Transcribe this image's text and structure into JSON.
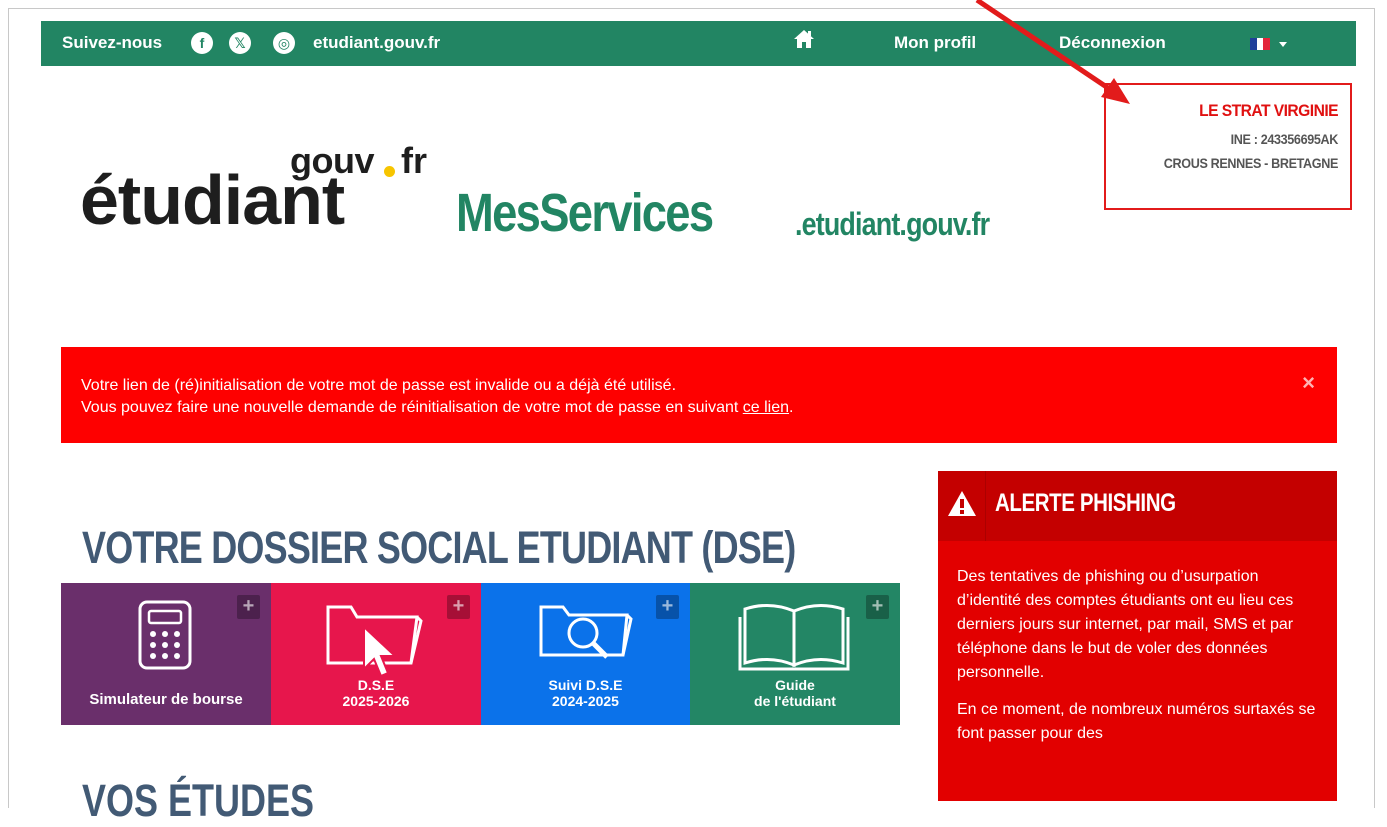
{
  "topbar": {
    "follow_label": "Suivez-nous",
    "social": {
      "facebook": "f",
      "x": "𝕏",
      "instagram": "◎"
    },
    "site_link": "etudiant.gouv.fr",
    "profile_label": "Mon profil",
    "logout_label": "Déconnexion"
  },
  "user": {
    "name": "LE STRAT VIRGINIE",
    "ine": "INE : 243356695AK",
    "crous": "CROUS RENNES - BRETAGNE"
  },
  "logo": {
    "gouv": "gouv",
    "fr": "fr",
    "etudiant": "étudiant",
    "services": "MesServices",
    "domain": ".etudiant.gouv.fr"
  },
  "alert": {
    "line1": "Votre lien de (ré)initialisation de votre mot de passe est invalide ou a déjà été utilisé.",
    "line2_prefix": "Vous pouvez faire une nouvelle demande de réinitialisation de votre mot de passe en suivant ",
    "link_label": "ce lien",
    "line2_suffix": ".",
    "close": "×"
  },
  "dse": {
    "title": "VOTRE DOSSIER SOCIAL ETUDIANT (DSE)",
    "tiles": [
      {
        "line1": "Simulateur de bourse",
        "line2": "",
        "color": "#6a2f6b",
        "icon": "calculator-icon"
      },
      {
        "line1": "D.S.E",
        "line2": "2025-2026",
        "color": "#e7164c",
        "icon": "folder-cursor-icon"
      },
      {
        "line1": "Suivi D.S.E",
        "line2": "2024-2025",
        "color": "#0b72ea",
        "icon": "folder-search-icon"
      },
      {
        "line1": "Guide",
        "line2": "de l'étudiant",
        "color": "#238665",
        "icon": "book-icon"
      }
    ],
    "plus": "+"
  },
  "phishing": {
    "title": "ALERTE PHISHING",
    "p1": "Des tentatives de phishing ou d’usurpation d’identité des comptes étudiants ont eu lieu ces derniers jours sur internet, par mail, SMS et par téléphone dans le but de voler des données personnelle.",
    "p2": "En ce moment, de nombreux numéros surtaxés se font passer pour des"
  },
  "studies": {
    "title": "VOS ÉTUDES"
  },
  "colors": {
    "green": "#228563",
    "alert_red": "#fe0000",
    "annotation_red": "#e21b1b"
  }
}
